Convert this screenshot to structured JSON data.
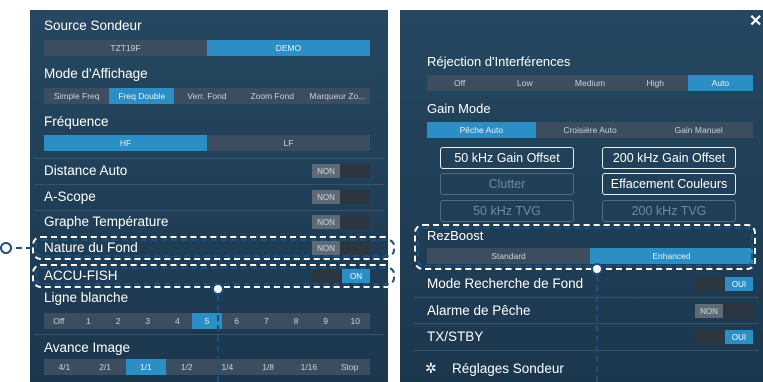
{
  "left_panel": {
    "source": {
      "label": "Source Sondeur",
      "options": [
        "TZT19F",
        "DEMO"
      ],
      "selected": 1
    },
    "display_mode": {
      "label": "Mode d'Affichage",
      "options": [
        "Simple Freq",
        "Freq Double",
        "Verr. Fond",
        "Zoom Fond",
        "Marqueur Zo..."
      ],
      "selected": 1
    },
    "frequency": {
      "label": "Fréquence",
      "options": [
        "HF",
        "LF"
      ],
      "selected": 0
    },
    "auto_distance": {
      "label": "Distance Auto",
      "state": "NON"
    },
    "ascope": {
      "label": "A-Scope",
      "state": "NON"
    },
    "temp_graph": {
      "label": "Graphe Température",
      "state": "NON"
    },
    "bottom_nature": {
      "label": "Nature du Fond",
      "state": "NON"
    },
    "accu_fish": {
      "label": "ACCU-FISH",
      "state": "ON"
    },
    "white_line": {
      "label": "Ligne blanche",
      "options": [
        "Off",
        "1",
        "2",
        "3",
        "4",
        "5",
        "6",
        "7",
        "8",
        "9",
        "10"
      ],
      "selected": 5
    },
    "picture_advance": {
      "label": "Avance Image",
      "options": [
        "4/1",
        "2/1",
        "1/1",
        "1/2",
        "1/4",
        "1/8",
        "1/16",
        "Stop"
      ],
      "selected": 2
    }
  },
  "right_panel": {
    "close_icon": "✕",
    "interference": {
      "label": "Réjection d'Interférences",
      "options": [
        "Off",
        "Low",
        "Medium",
        "High",
        "Auto"
      ],
      "selected": 4
    },
    "gain_mode": {
      "label": "Gain Mode",
      "options": [
        "Pêche Auto",
        "Croisière Auto",
        "Gain Manuel"
      ],
      "selected": 0
    },
    "buttons": {
      "gain50": "50 kHz Gain Offset",
      "gain200": "200 kHz Gain Offset",
      "clutter": "Clutter",
      "color_erase": "Effacement Couleurs",
      "tvg50": "50 kHz TVG",
      "tvg200": "200 kHz TVG"
    },
    "rezboost": {
      "label": "RezBoost",
      "options": [
        "Standard",
        "Enhanced"
      ],
      "selected": 1
    },
    "bottom_search": {
      "label": "Mode Recherche de Fond",
      "state": "OUI"
    },
    "fish_alarm": {
      "label": "Alarme de Pêche",
      "state": "NON"
    },
    "tx_stby": {
      "label": "TX/STBY",
      "state": "OUI"
    },
    "sounder_settings": "Réglages Sondeur"
  },
  "colors": {
    "panel": "#1d3a52",
    "accent": "#2b8fc6",
    "callout": "#1b4f7e"
  }
}
